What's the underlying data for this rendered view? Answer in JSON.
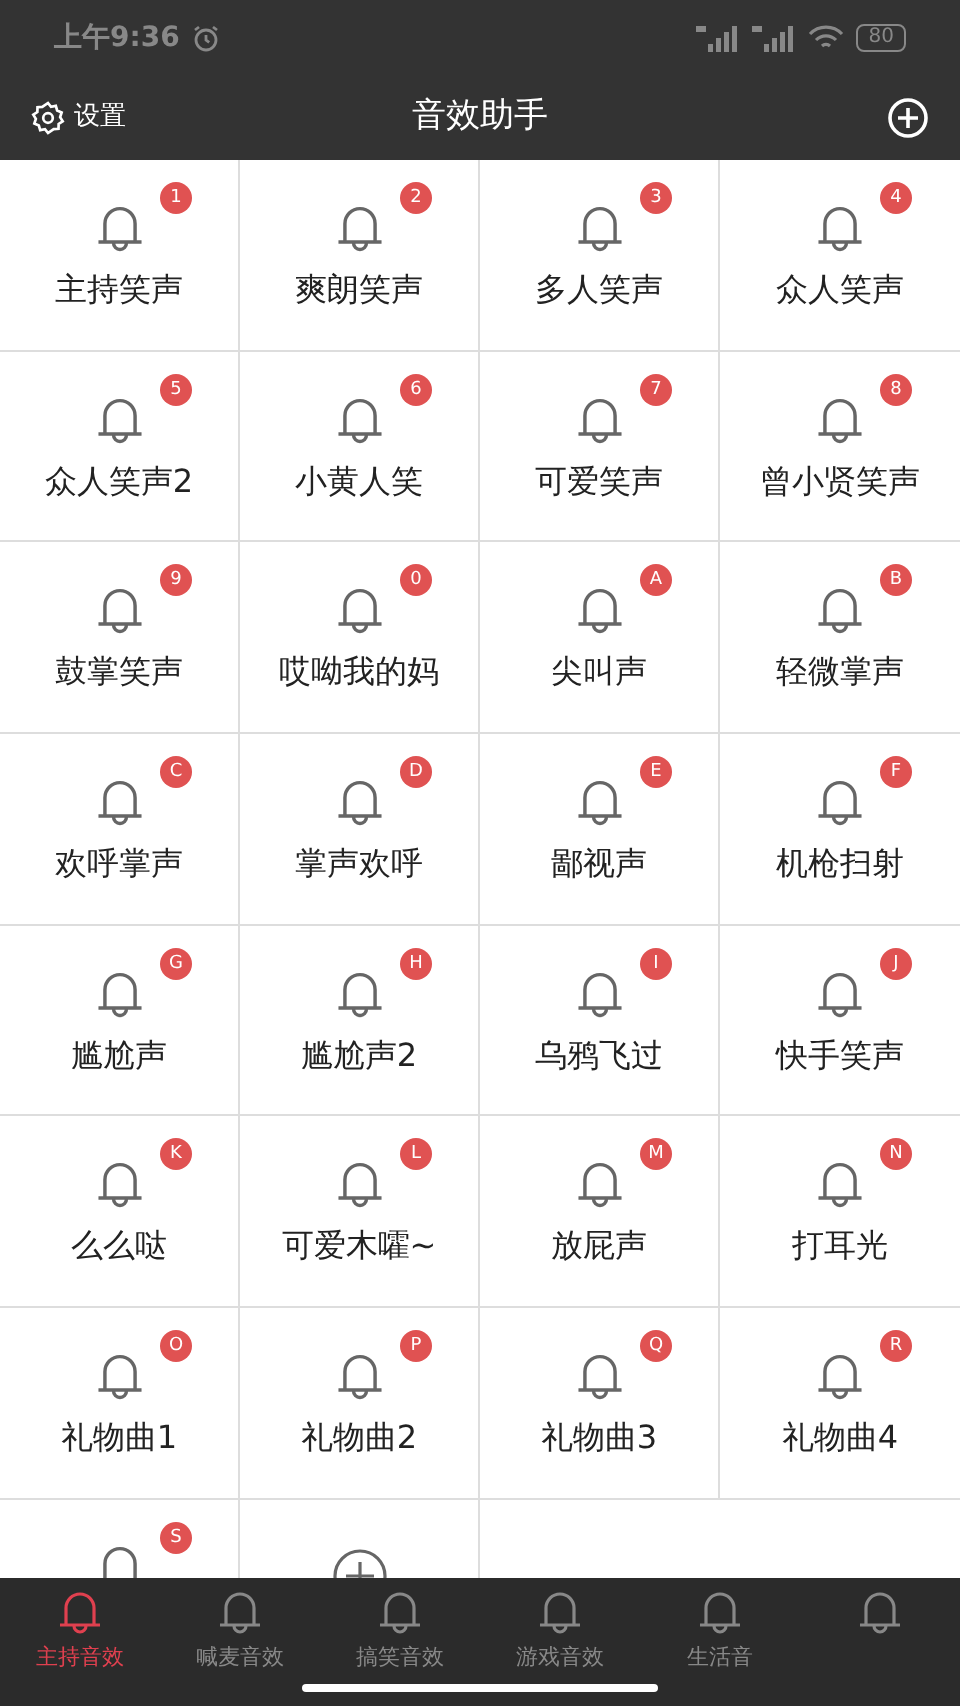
{
  "status_bar": {
    "time": "上午9:36",
    "battery": "80"
  },
  "header": {
    "settings_label": "设置",
    "title": "音效助手"
  },
  "sounds": [
    {
      "kind": "sound",
      "label": "主持笑声",
      "badge": "1"
    },
    {
      "kind": "sound",
      "label": "爽朗笑声",
      "badge": "2"
    },
    {
      "kind": "sound",
      "label": "多人笑声",
      "badge": "3"
    },
    {
      "kind": "sound",
      "label": "众人笑声",
      "badge": "4"
    },
    {
      "kind": "sound",
      "label": "众人笑声2",
      "badge": "5"
    },
    {
      "kind": "sound",
      "label": "小黄人笑",
      "badge": "6"
    },
    {
      "kind": "sound",
      "label": "可爱笑声",
      "badge": "7"
    },
    {
      "kind": "sound",
      "label": "曾小贤笑声",
      "badge": "8"
    },
    {
      "kind": "sound",
      "label": "鼓掌笑声",
      "badge": "9"
    },
    {
      "kind": "sound",
      "label": "哎呦我的妈",
      "badge": "0"
    },
    {
      "kind": "sound",
      "label": "尖叫声",
      "badge": "A"
    },
    {
      "kind": "sound",
      "label": "轻微掌声",
      "badge": "B"
    },
    {
      "kind": "sound",
      "label": "欢呼掌声",
      "badge": "C"
    },
    {
      "kind": "sound",
      "label": "掌声欢呼",
      "badge": "D"
    },
    {
      "kind": "sound",
      "label": "鄙视声",
      "badge": "E"
    },
    {
      "kind": "sound",
      "label": "机枪扫射",
      "badge": "F"
    },
    {
      "kind": "sound",
      "label": "尴尬声",
      "badge": "G"
    },
    {
      "kind": "sound",
      "label": "尴尬声2",
      "badge": "H"
    },
    {
      "kind": "sound",
      "label": "乌鸦飞过",
      "badge": "I"
    },
    {
      "kind": "sound",
      "label": "快手笑声",
      "badge": "J"
    },
    {
      "kind": "sound",
      "label": "么么哒",
      "badge": "K"
    },
    {
      "kind": "sound",
      "label": "可爱木嚯~",
      "badge": "L"
    },
    {
      "kind": "sound",
      "label": "放屁声",
      "badge": "M"
    },
    {
      "kind": "sound",
      "label": "打耳光",
      "badge": "N"
    },
    {
      "kind": "sound",
      "label": "礼物曲1",
      "badge": "O"
    },
    {
      "kind": "sound",
      "label": "礼物曲2",
      "badge": "P"
    },
    {
      "kind": "sound",
      "label": "礼物曲3",
      "badge": "Q"
    },
    {
      "kind": "sound",
      "label": "礼物曲4",
      "badge": "R"
    },
    {
      "kind": "sound",
      "badge": "S"
    },
    {
      "kind": "add"
    }
  ],
  "tabs": [
    {
      "label": "主持音效",
      "selected": true
    },
    {
      "label": "喊麦音效",
      "selected": false
    },
    {
      "label": "搞笑音效",
      "selected": false
    },
    {
      "label": "游戏音效",
      "selected": false
    },
    {
      "label": "生活音",
      "selected": false
    },
    {
      "selected": false
    }
  ]
}
